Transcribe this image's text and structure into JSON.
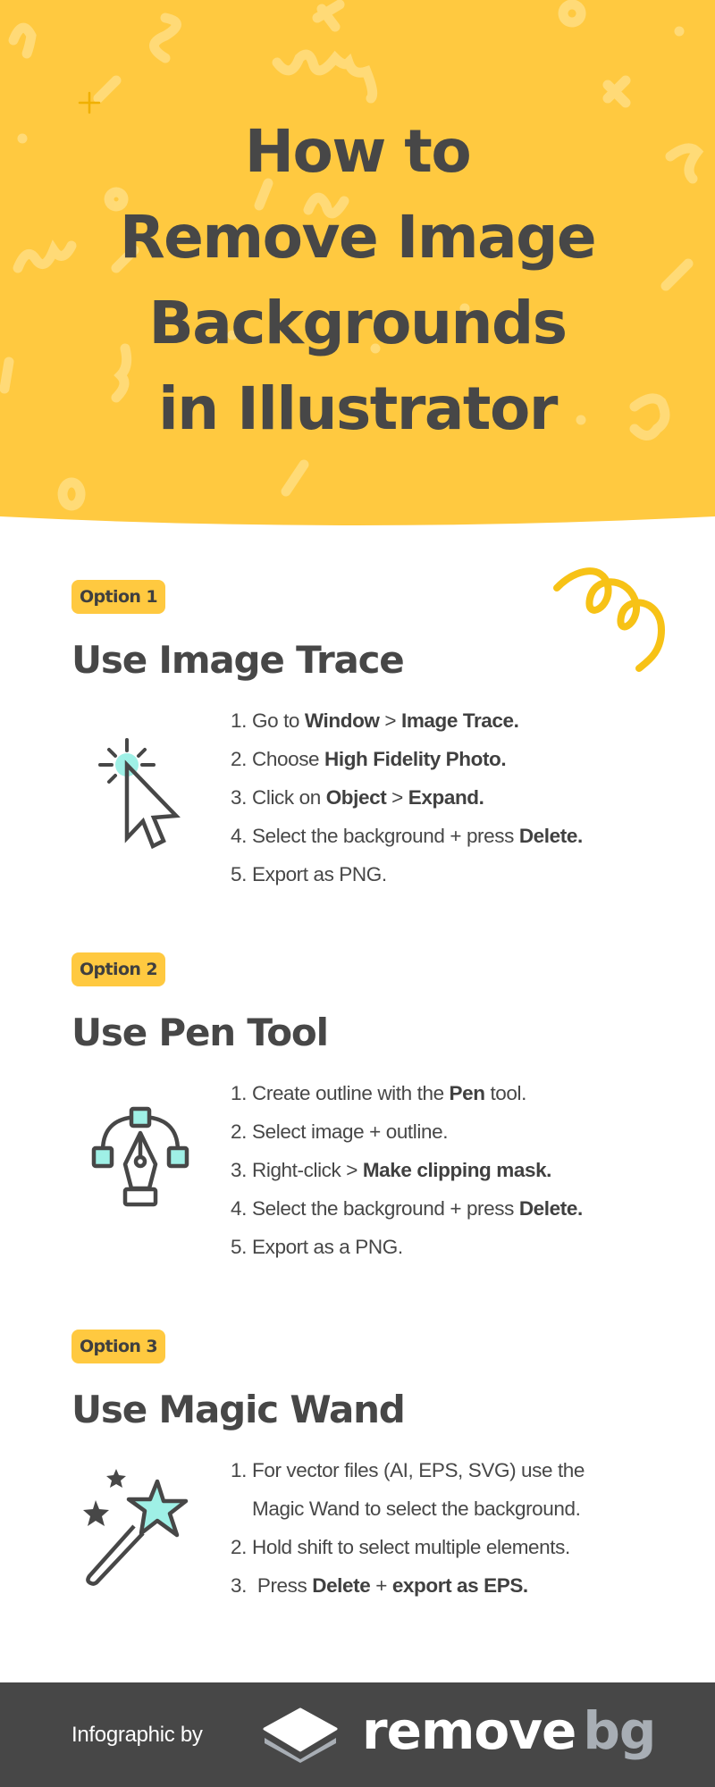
{
  "colors": {
    "header_yellow": "#ffc940",
    "text_dark": "#474747",
    "accent_mint": "#9ff0e6",
    "footer_dark": "#474747",
    "logo_gray": "#a8aeb5"
  },
  "header": {
    "title_lines": [
      "How to",
      "Remove Image",
      "Backgrounds",
      "in Illustrator"
    ]
  },
  "sections": [
    {
      "badge": "Option 1",
      "title": "Use Image Trace",
      "icon": "cursor-click-icon",
      "steps": [
        {
          "num": "1.",
          "parts": [
            [
              "Go to ",
              false
            ],
            [
              "Window",
              true
            ],
            [
              " > ",
              false
            ],
            [
              "Image Trace.",
              true
            ]
          ]
        },
        {
          "num": "2.",
          "parts": [
            [
              "Choose ",
              false
            ],
            [
              "High Fidelity Photo.",
              true
            ]
          ]
        },
        {
          "num": "3.",
          "parts": [
            [
              "Click on ",
              false
            ],
            [
              "Object",
              true
            ],
            [
              " > ",
              false
            ],
            [
              "Expand.",
              true
            ]
          ]
        },
        {
          "num": "4.",
          "parts": [
            [
              "Select the background + press ",
              false
            ],
            [
              "Delete.",
              true
            ]
          ]
        },
        {
          "num": "5.",
          "parts": [
            [
              "Export as PNG.",
              false
            ]
          ]
        }
      ]
    },
    {
      "badge": "Option 2",
      "title": "Use Pen Tool",
      "icon": "pen-tool-icon",
      "steps": [
        {
          "num": "1.",
          "parts": [
            [
              "Create outline with the ",
              false
            ],
            [
              "Pen",
              true
            ],
            [
              " tool.",
              false
            ]
          ]
        },
        {
          "num": "2.",
          "parts": [
            [
              "Select image + outline.",
              false
            ]
          ]
        },
        {
          "num": "3.",
          "parts": [
            [
              "Right-click > ",
              false
            ],
            [
              "Make clipping mask.",
              true
            ]
          ]
        },
        {
          "num": "4.",
          "parts": [
            [
              "Select the background + press ",
              false
            ],
            [
              "Delete.",
              true
            ]
          ]
        },
        {
          "num": "5.",
          "parts": [
            [
              "Export as a PNG.",
              false
            ]
          ]
        }
      ]
    },
    {
      "badge": "Option 3",
      "title": "Use Magic Wand",
      "icon": "magic-wand-icon",
      "steps": [
        {
          "num": "1.",
          "parts": [
            [
              "For vector files (AI, EPS, SVG) use the",
              false
            ]
          ]
        },
        {
          "num": "",
          "cont": true,
          "parts": [
            [
              "Magic Wand to select the background.",
              false
            ]
          ]
        },
        {
          "num": "2.",
          "parts": [
            [
              "Hold shift to select multiple elements.",
              false
            ]
          ]
        },
        {
          "num": "3.",
          "parts": [
            [
              " Press ",
              false
            ],
            [
              "Delete",
              true
            ],
            [
              " + ",
              false
            ],
            [
              "export as EPS.",
              true
            ]
          ]
        }
      ]
    }
  ],
  "footer": {
    "credit": "Infographic by",
    "logo_icon": "layers-icon",
    "logo_word_primary": "remove",
    "logo_word_secondary": "bg"
  }
}
